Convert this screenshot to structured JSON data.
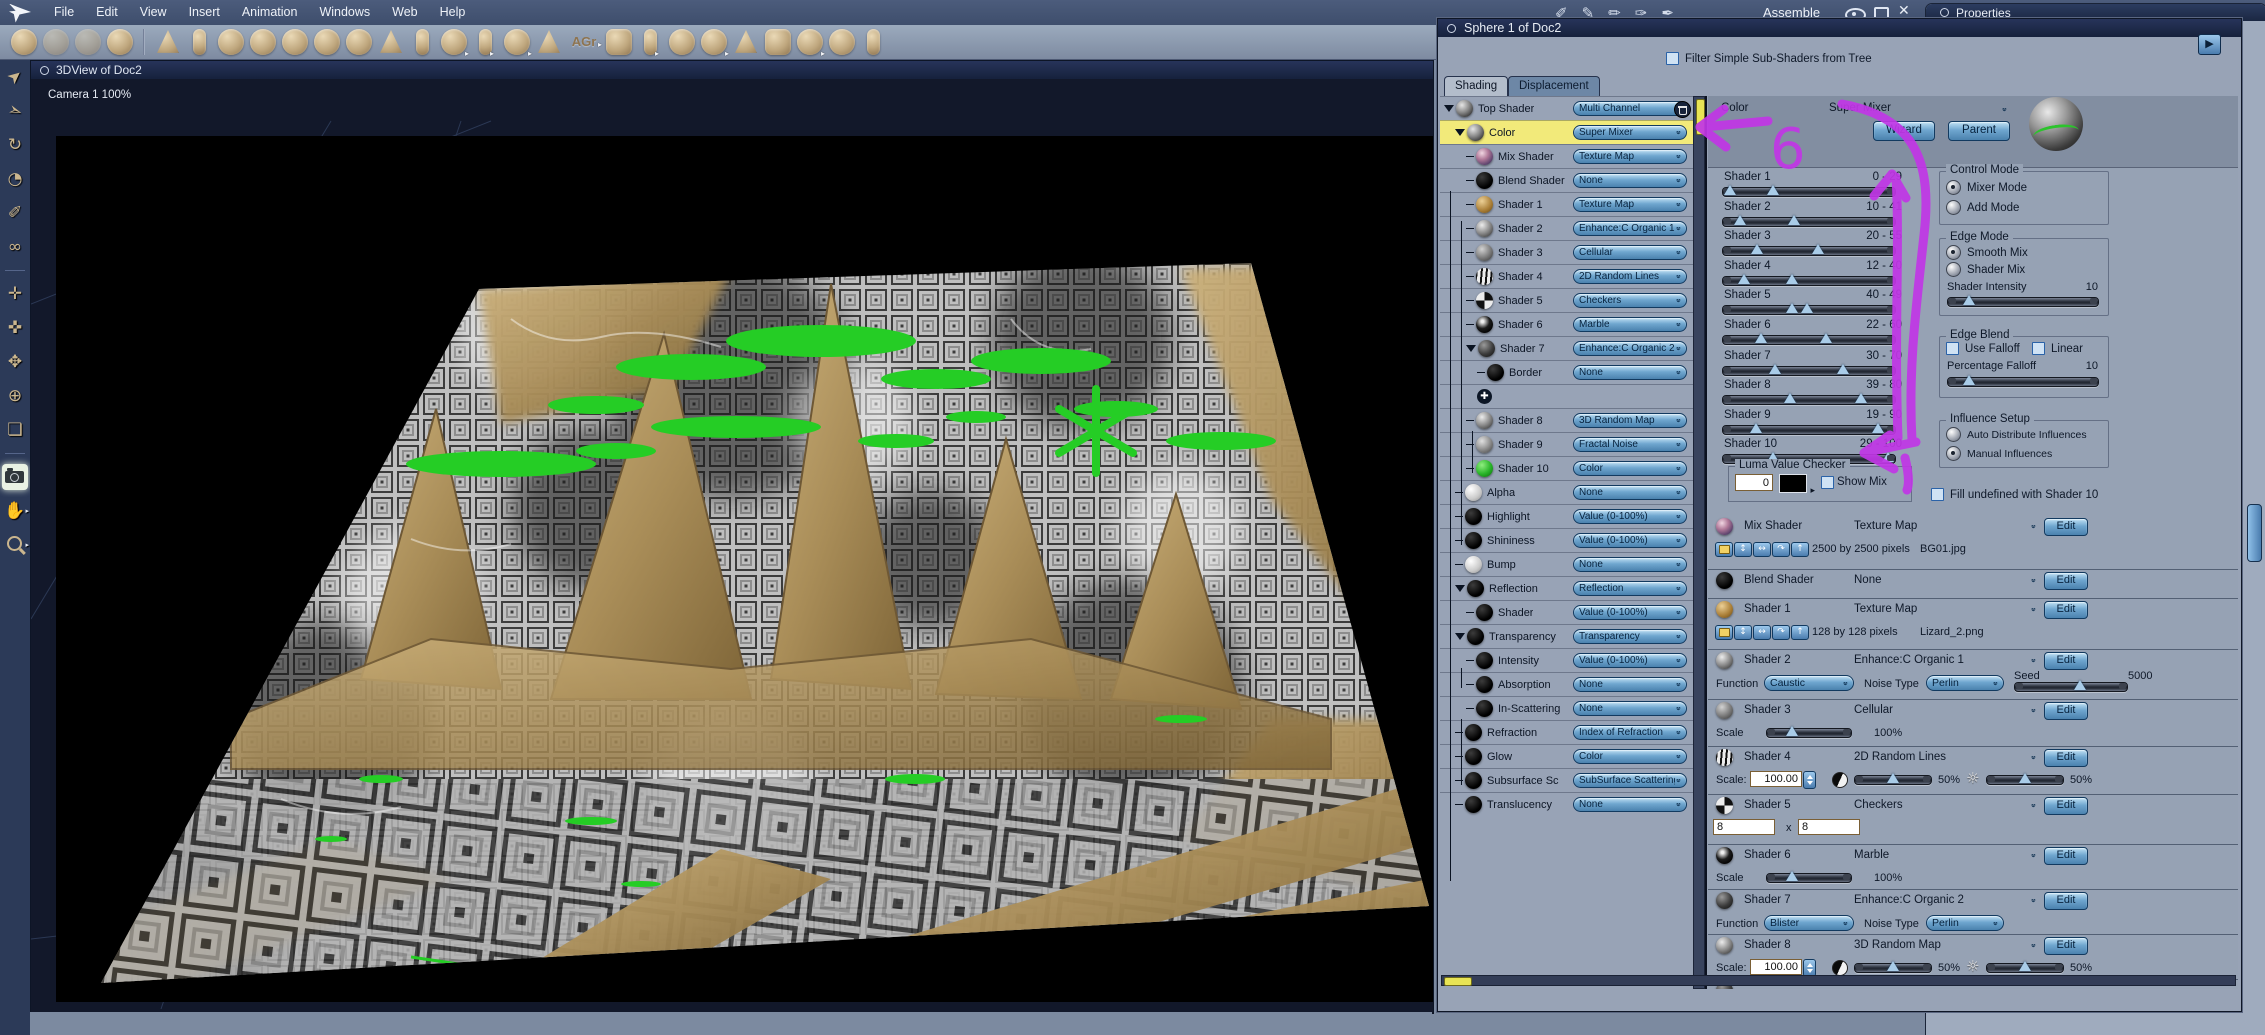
{
  "app": {
    "assemble_label": "Assemble",
    "properties_title": "Properties"
  },
  "colors": {
    "selection_yellow": "#f2ea7a",
    "annotation_purple": "#c136e6",
    "shader10_green": "#25cd25",
    "dropdown_blue": "#6fa6cf"
  },
  "menubar": {
    "menus": [
      "File",
      "Edit",
      "View",
      "Insert",
      "Animation",
      "Windows",
      "Web",
      "Help"
    ],
    "right_icons": [
      {
        "name": "knife-icon",
        "glyph": "✐"
      },
      {
        "name": "pen-icon",
        "glyph": "✎"
      },
      {
        "name": "pencil-icon",
        "glyph": "✏"
      },
      {
        "name": "quill-icon",
        "glyph": "✑"
      },
      {
        "name": "ink-pen-icon",
        "glyph": "✒"
      }
    ]
  },
  "toolbar": {
    "agr_label": "AGr",
    "tools": [
      {
        "name": "joint-tool-icon",
        "shape": "round"
      },
      {
        "name": "pan-hand-tool-icon",
        "shape": "round",
        "grayed": true
      },
      {
        "name": "paint-tool-icon",
        "shape": "round",
        "grayed": true
      },
      {
        "name": "push-tool-icon",
        "shape": "round"
      },
      {
        "sep": true
      },
      {
        "name": "cone-primitive-icon",
        "shape": "cone",
        "marker": true
      },
      {
        "name": "wine-glass-icon",
        "shape": "tall"
      },
      {
        "name": "sphere-primitive-icon",
        "shape": "round"
      },
      {
        "name": "bones-icon",
        "shape": "round"
      },
      {
        "name": "spiral-icon",
        "shape": "round"
      },
      {
        "name": "text-tool-icon",
        "shape": "round"
      },
      {
        "name": "particles-icon",
        "shape": "round"
      },
      {
        "name": "terrain-icon",
        "shape": "cone"
      },
      {
        "name": "tree-icon",
        "shape": "tall"
      },
      {
        "name": "cloud-icon",
        "shape": "round",
        "marker": true
      },
      {
        "name": "fire-icon",
        "shape": "tall",
        "marker": true
      },
      {
        "name": "checkered-ball-icon",
        "shape": "round",
        "marker": true
      },
      {
        "name": "fountain-icon",
        "shape": "cone"
      },
      {
        "name": "agr-generator-icon",
        "shape": "text",
        "marker": true
      },
      {
        "name": "house-icon",
        "shape": ""
      },
      {
        "name": "capsule-icon",
        "shape": "tall",
        "marker": true
      },
      {
        "name": "wave-icon",
        "shape": "round"
      },
      {
        "name": "rock-icon",
        "shape": "round",
        "marker": true
      },
      {
        "name": "spotlight-icon",
        "shape": "cone",
        "marker": true
      },
      {
        "name": "movie-camera-icon",
        "shape": ""
      },
      {
        "name": "group-icon",
        "shape": "round",
        "marker": true
      },
      {
        "name": "target-icon",
        "shape": "round"
      },
      {
        "name": "bone-icon",
        "shape": "tall"
      }
    ]
  },
  "palette": {
    "tools": [
      {
        "name": "select-tool-icon",
        "glyph": "➤",
        "rot": -40
      },
      {
        "name": "glider-tool-icon",
        "glyph": "➣",
        "rot": 20
      },
      {
        "name": "rotate-tool-icon",
        "glyph": "↻"
      },
      {
        "name": "ring-tool-icon",
        "glyph": "◔"
      },
      {
        "name": "eyedropper-tool-icon",
        "glyph": "✐"
      },
      {
        "name": "link-tool-icon",
        "glyph": "∞"
      },
      {
        "sep": true
      },
      {
        "name": "pan-camera-icon",
        "glyph": "✛"
      },
      {
        "name": "dolly-camera-icon",
        "glyph": "✜"
      },
      {
        "name": "track-camera-icon",
        "glyph": "✥"
      },
      {
        "name": "orbit-camera-icon",
        "glyph": "⊕"
      },
      {
        "name": "bank-camera-icon",
        "glyph": "❏"
      },
      {
        "sep": true
      },
      {
        "name": "camera-tool-icon",
        "special": "camera",
        "highlight": true
      },
      {
        "name": "hand-tool-icon",
        "glyph": "✋",
        "marker": true
      },
      {
        "name": "zoom-tool-icon",
        "special": "magnifier",
        "marker": true
      }
    ]
  },
  "windows": {
    "view_title": "3DView of Doc2",
    "camera_label": "Camera 1 100%",
    "sphere_title": "Sphere 1 of Doc2",
    "filter_label": "Filter Simple Sub-Shaders from Tree",
    "tabs": {
      "shading": "Shading",
      "displacement": "Displacement"
    }
  },
  "tree": {
    "items": [
      {
        "label": "Top Shader",
        "type": "Multi Channel",
        "thumb": "grayTex",
        "indent": 0,
        "expand": true,
        "trash": true
      },
      {
        "label": "Color",
        "type": "Super Mixer",
        "thumb": "grayTex",
        "indent": 1,
        "expand": true,
        "selected": true
      },
      {
        "label": "Mix Shader",
        "type": "Texture Map",
        "thumb": "swirl",
        "indent": 2
      },
      {
        "label": "Blend Shader",
        "type": "None",
        "thumb": "black",
        "indent": 2
      },
      {
        "label": "Shader 1",
        "type": "Texture Map",
        "thumb": "gold",
        "indent": 2
      },
      {
        "label": "Shader 2",
        "type": "Enhance:C Organic 1",
        "thumb": "speckle",
        "indent": 2
      },
      {
        "label": "Shader 3",
        "type": "Cellular",
        "thumb": "cellular",
        "indent": 2
      },
      {
        "label": "Shader 4",
        "type": "2D Random Lines",
        "thumb": "stripes",
        "indent": 2
      },
      {
        "label": "Shader 5",
        "type": "Checkers",
        "thumb": "checker",
        "indent": 2
      },
      {
        "label": "Shader 6",
        "type": "Marble",
        "thumb": "marble",
        "indent": 2
      },
      {
        "label": "Shader 7",
        "type": "Enhance:C Organic 2",
        "thumb": "dark",
        "indent": 2,
        "expand": true
      },
      {
        "label": "Border",
        "type": "None",
        "thumb": "black",
        "indent": 3
      },
      {
        "add": true,
        "indent": 3
      },
      {
        "label": "Shader 8",
        "type": "3D Random Map",
        "thumb": "speckle",
        "indent": 2
      },
      {
        "label": "Shader 9",
        "type": "Fractal Noise",
        "thumb": "fractal",
        "indent": 2
      },
      {
        "label": "Shader 10",
        "type": "Color",
        "thumb": "green",
        "indent": 2
      },
      {
        "label": "Alpha",
        "type": "None",
        "thumb": "white",
        "indent": 1
      },
      {
        "label": "Highlight",
        "type": "Value (0-100%)",
        "thumb": "black",
        "indent": 1
      },
      {
        "label": "Shininess",
        "type": "Value (0-100%)",
        "thumb": "black",
        "indent": 1
      },
      {
        "label": "Bump",
        "type": "None",
        "thumb": "white",
        "indent": 1
      },
      {
        "label": "Reflection",
        "type": "Reflection",
        "thumb": "black",
        "indent": 1,
        "expand": true
      },
      {
        "label": "Shader",
        "type": "Value (0-100%)",
        "thumb": "black",
        "indent": 2
      },
      {
        "label": "Transparency",
        "type": "Transparency",
        "thumb": "black",
        "indent": 1,
        "expand": true
      },
      {
        "label": "Intensity",
        "type": "Value (0-100%)",
        "thumb": "black",
        "indent": 2
      },
      {
        "label": "Absorption",
        "type": "None",
        "thumb": "black",
        "indent": 2
      },
      {
        "label": "In-Scattering",
        "type": "None",
        "thumb": "black",
        "indent": 2
      },
      {
        "label": "Refraction",
        "type": "Index of Refraction",
        "thumb": "black",
        "indent": 1
      },
      {
        "label": "Glow",
        "type": "Color",
        "thumb": "black",
        "indent": 1
      },
      {
        "label": "Subsurface Sc",
        "type": "SubSurface Scattering",
        "thumb": "black",
        "indent": 1
      },
      {
        "label": "Translucency",
        "type": "None",
        "thumb": "black",
        "indent": 1
      }
    ]
  },
  "detail": {
    "header": {
      "channel": "Color",
      "shader_type": "Super Mixer",
      "wizard": "Wizard",
      "parent": "Parent"
    },
    "sliders": [
      {
        "name": "Shader 1",
        "range": "0 - 29",
        "min": 0,
        "max": 29
      },
      {
        "name": "Shader 2",
        "range": "10 - 41",
        "min": 10,
        "max": 41
      },
      {
        "name": "Shader 3",
        "range": "20 - 55",
        "min": 20,
        "max": 55
      },
      {
        "name": "Shader 4",
        "range": "12 - 40",
        "min": 12,
        "max": 40
      },
      {
        "name": "Shader 5",
        "range": "40 - 49",
        "min": 40,
        "max": 49
      },
      {
        "name": "Shader 6",
        "range": "22 - 60",
        "min": 22,
        "max": 60
      },
      {
        "name": "Shader 7",
        "range": "30 - 70",
        "min": 30,
        "max": 70
      },
      {
        "name": "Shader 8",
        "range": "39 - 80",
        "min": 39,
        "max": 80
      },
      {
        "name": "Shader 9",
        "range": "19 - 90",
        "min": 19,
        "max": 90
      },
      {
        "name": "Shader 10",
        "range": "29 - 100",
        "min": 29,
        "max": 100
      }
    ],
    "luma": {
      "label": "Luma Value Checker",
      "value": "0",
      "show_mix": "Show Mix"
    },
    "control_mode": {
      "label": "Control Mode",
      "options": [
        "Mixer Mode",
        "Add Mode"
      ],
      "selected": "Mixer Mode"
    },
    "edge_mode": {
      "label": "Edge Mode",
      "options": [
        "Smooth Mix",
        "Shader Mix"
      ],
      "selected": "Smooth Mix",
      "intensity_label": "Shader Intensity",
      "intensity_value": "10"
    },
    "edge_blend": {
      "label": "Edge Blend",
      "use_falloff": "Use Falloff",
      "linear": "Linear",
      "falloff_label": "Percentage Falloff",
      "falloff_value": "10"
    },
    "influence": {
      "label": "Influence Setup",
      "options": [
        "Auto Distribute Influences",
        "Manual Influences"
      ],
      "selected": "Manual Influences"
    },
    "fill_label": "Fill undefined with Shader 10",
    "edit_label": "Edit",
    "rows": [
      {
        "name": "Mix Shader",
        "type": "Texture Map",
        "thumb": "swirl",
        "sub": "texmap",
        "dims": "2500 by 2500 pixels",
        "file": "BG01.jpg"
      },
      {
        "name": "Blend Shader",
        "type": "None",
        "thumb": "black",
        "sub": "none"
      },
      {
        "name": "Shader 1",
        "type": "Texture Map",
        "thumb": "gold",
        "sub": "texmap",
        "dims": "128 by 128 pixels",
        "file": "Lizard_2.png"
      },
      {
        "name": "Shader 2",
        "type": "Enhance:C Organic 1",
        "thumb": "speckle",
        "sub": "organic",
        "function_label": "Function",
        "function": "Caustic",
        "noise_label": "Noise Type",
        "noise": "Perlin",
        "seed_label": "Seed",
        "seed": "5000"
      },
      {
        "name": "Shader 3",
        "type": "Cellular",
        "thumb": "cellular",
        "sub": "scale",
        "scale_label": "Scale",
        "scale": "100%"
      },
      {
        "name": "Shader 4",
        "type": "2D Random Lines",
        "thumb": "stripes",
        "sub": "scalecb",
        "scale_label": "Scale:",
        "scale_value": "100.00",
        "contrast": "50%",
        "brightness": "50%"
      },
      {
        "name": "Shader 5",
        "type": "Checkers",
        "thumb": "checker",
        "sub": "checkers",
        "h": "8",
        "x_label": "x",
        "v": "8"
      },
      {
        "name": "Shader 6",
        "type": "Marble",
        "thumb": "marble",
        "sub": "scale",
        "scale_label": "Scale",
        "scale": "100%"
      },
      {
        "name": "Shader 7",
        "type": "Enhance:C Organic 2",
        "thumb": "dark",
        "sub": "organic2",
        "function_label": "Function",
        "function": "Blister",
        "noise_label": "Noise Type",
        "noise": "Perlin"
      },
      {
        "name": "Shader 8",
        "type": "3D Random Map",
        "thumb": "speckle",
        "sub": "scalecb",
        "scale_label": "Scale:",
        "scale_value": "100.00",
        "contrast": "50%",
        "brightness": "50%"
      },
      {
        "name": "",
        "type": "",
        "thumb": "dark",
        "sub": "partial"
      }
    ]
  },
  "annotation": {
    "text": "6"
  }
}
